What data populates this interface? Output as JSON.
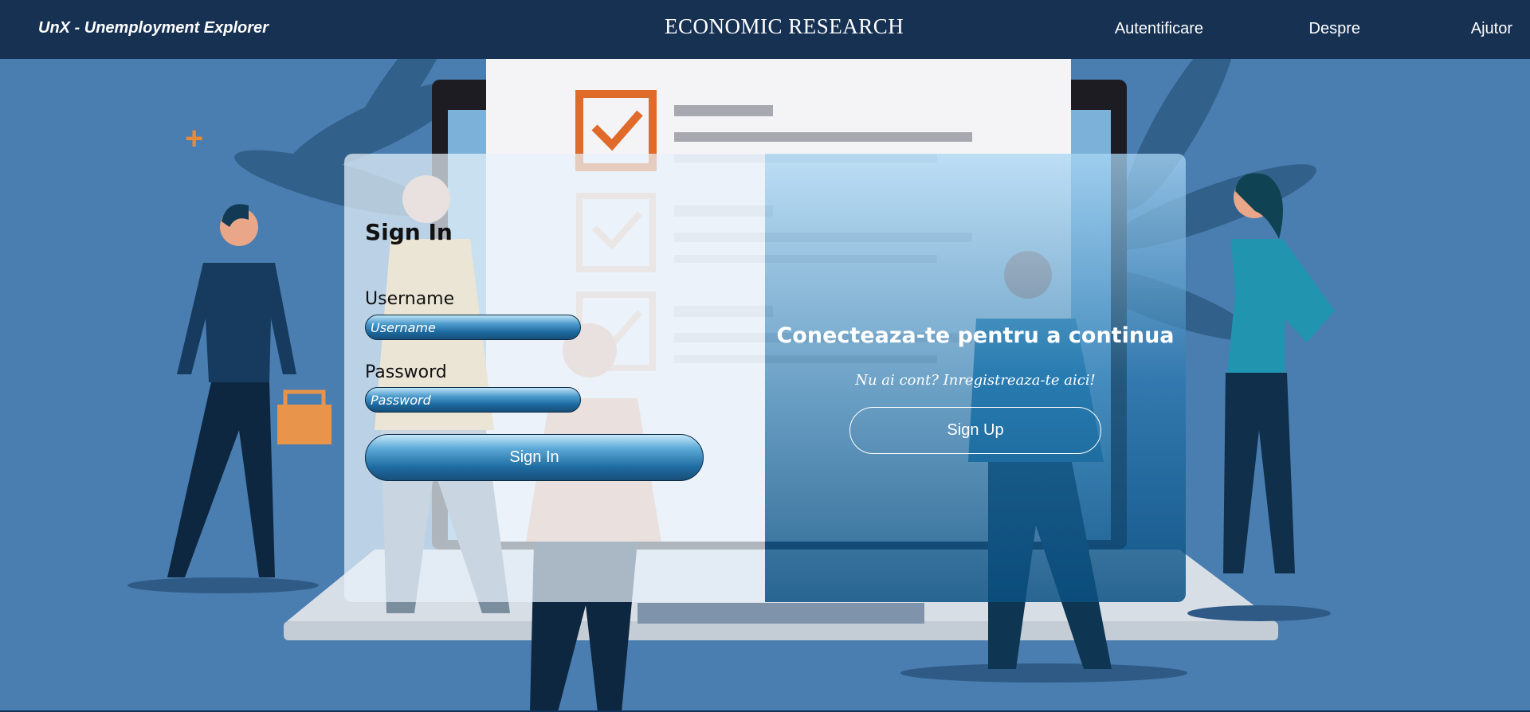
{
  "app": {
    "brand": "UnX - Unemployment Explorer"
  },
  "nav": {
    "items": [
      {
        "label": "Autentificare"
      },
      {
        "label": "Despre"
      },
      {
        "label": "Ajutor"
      }
    ]
  },
  "illustration": {
    "banner_text": "ECONOMIC RESEARCH"
  },
  "signin": {
    "title": "Sign In",
    "username_label": "Username",
    "username_placeholder": "Username",
    "password_label": "Password",
    "password_placeholder": "Password",
    "button_label": "Sign In"
  },
  "signup_panel": {
    "title": "Conecteaza-te pentru a continua",
    "subtitle": "Nu ai cont? Inregistreaza-te aici!",
    "button_label": "Sign Up"
  },
  "colors": {
    "navbar": "#173152",
    "background": "#4a7db0",
    "accent_orange": "#e58a3a"
  }
}
